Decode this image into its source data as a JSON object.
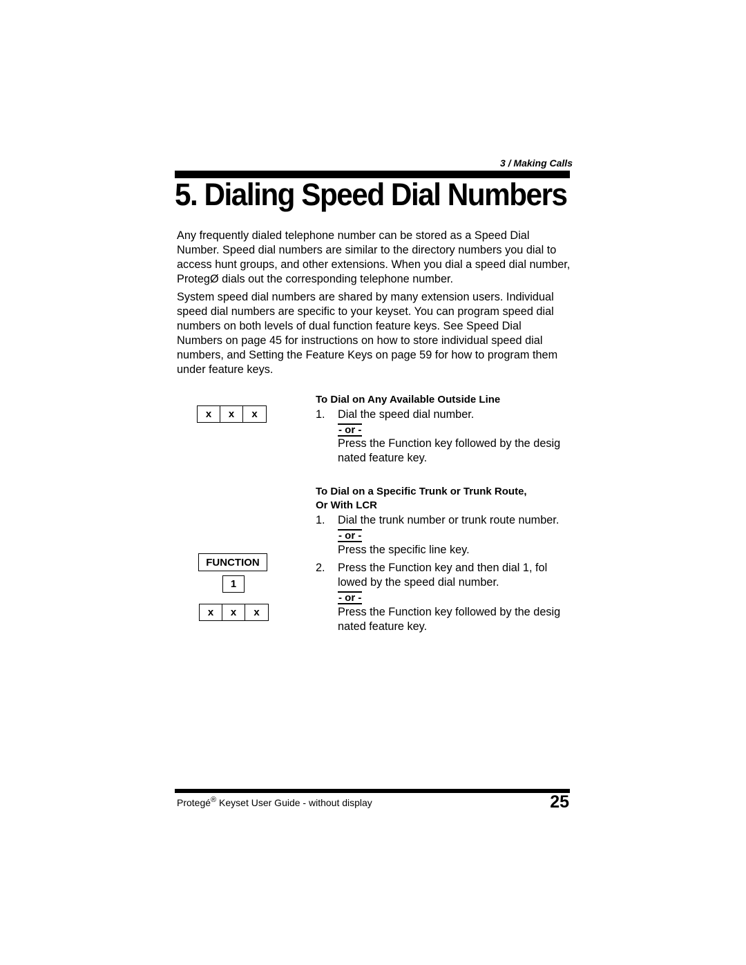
{
  "header": {
    "section_tag": "3 / Making Calls",
    "title": "5. Dialing Speed Dial Numbers"
  },
  "intro": {
    "paragraph1": [
      "Any frequently dialed telephone number can be stored as a Speed Dial",
      "Number. Speed dial numbers are similar to the directory numbers you dial to",
      "access hunt groups, and other extensions. When you dial a speed dial number,",
      "ProtegØ dials out the corresponding telephone number."
    ],
    "paragraph2": [
      "System speed dial numbers are shared by many extension users. Individual",
      "speed dial numbers are specific to your keyset. You can program speed dial",
      "numbers on both  levels  of dual function feature keys. See Speed Dial",
      "Numbers on page 45 for instructions on how to store individual speed dial",
      "numbers, and Setting the Feature Keys on page 59 for how to program them",
      "under feature keys."
    ]
  },
  "procedures": [
    {
      "heading": "To Dial on Any Available Outside Line",
      "steps": [
        {
          "number": "1.",
          "text": "Dial the speed dial number.",
          "or_label": "- or -",
          "alt_lines": [
            "Press the Function key followed by the desig",
            "nated feature key."
          ]
        }
      ]
    },
    {
      "heading_lines": [
        "To Dial on a Specific Trunk or Trunk Route,",
        "Or With LCR"
      ],
      "steps": [
        {
          "number": "1.",
          "text": "Dial the trunk number or trunk route number.",
          "or_label": "- or -",
          "alt_lines": [
            "Press the specific line key."
          ]
        },
        {
          "number": "2.",
          "text_lines": [
            "Press the Function key and then dial 1, fol",
            "lowed by the speed dial number."
          ],
          "or_label": "- or -",
          "alt_lines": [
            "Press the Function key followed by the desig",
            "nated feature key."
          ]
        }
      ]
    }
  ],
  "keys": {
    "digit_placeholder": [
      "x",
      "x",
      "x"
    ],
    "function_label": "FUNCTION",
    "one_label": "1"
  },
  "footer": {
    "guide_title": "Protegé",
    "registered_mark": "®",
    "guide_subtitle": " Keyset User Guide - without display",
    "page_number": "25"
  }
}
